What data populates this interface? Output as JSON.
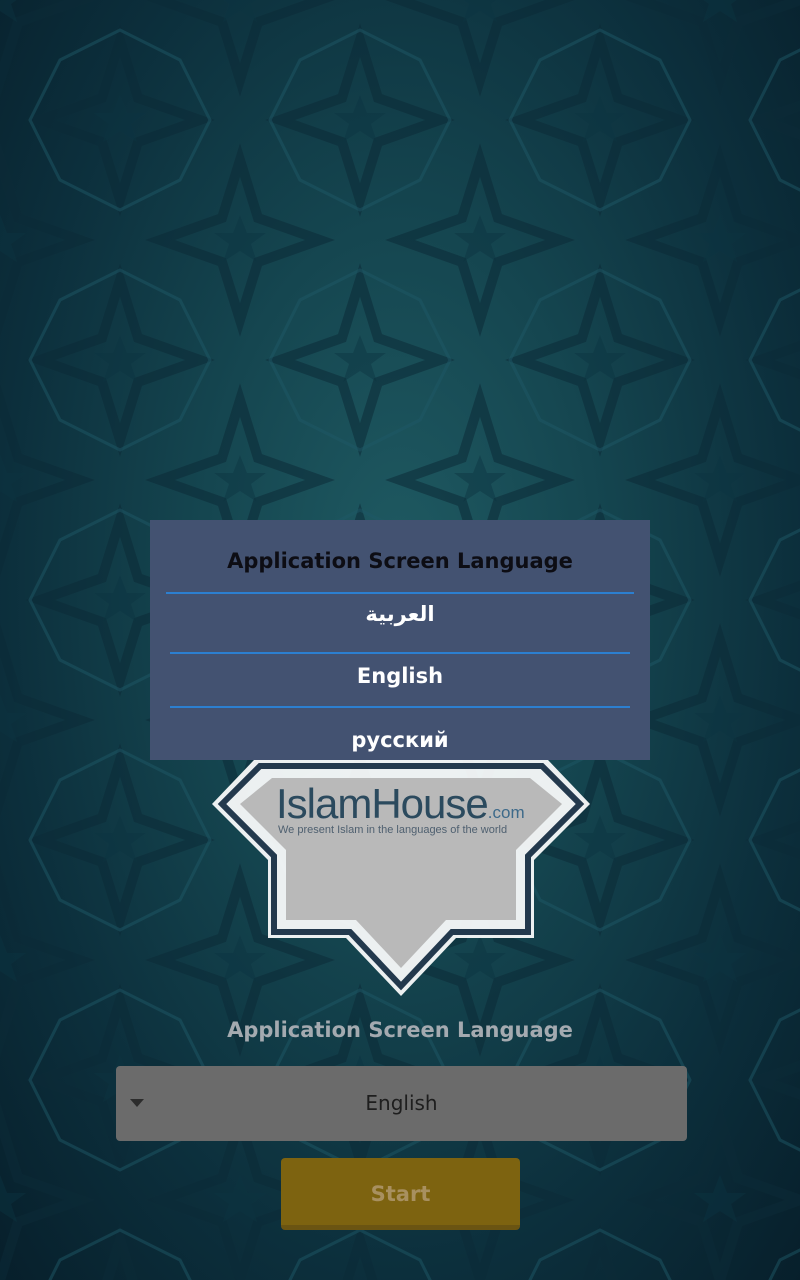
{
  "dialog": {
    "title": "Application Screen Language",
    "options": [
      {
        "label": "العربية"
      },
      {
        "label": "English"
      },
      {
        "label": "русский"
      }
    ]
  },
  "logo": {
    "brand": "IslamHouse",
    "domain_suffix": ".com",
    "tagline": "We present Islam in the languages of the world"
  },
  "language_section": {
    "heading": "Application Screen Language",
    "selected_language": "English"
  },
  "start_button": {
    "label": "Start"
  },
  "colors": {
    "dialog_background": "#435271",
    "divider_accent": "#2c7fd0",
    "start_button": "#7d6310",
    "select_background": "#6b6b6b"
  }
}
